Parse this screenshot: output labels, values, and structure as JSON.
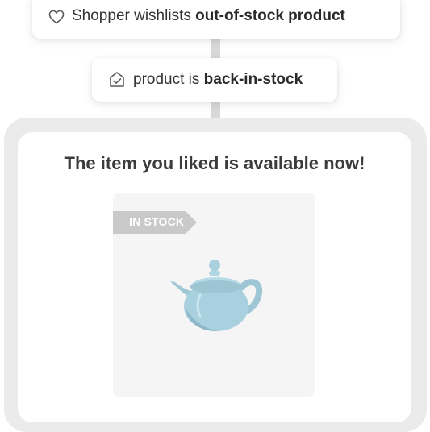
{
  "trigger": {
    "icon": "heart-icon",
    "prefix": "Shopper wishlists ",
    "bold": "out-of-stock product"
  },
  "condition": {
    "icon": "tag-check-icon",
    "prefix": "product is ",
    "bold": "back-in-stock"
  },
  "message": {
    "headline": "The item you liked is available now!",
    "badge": "IN STOCK",
    "product_image": "teapot-icon"
  },
  "colors": {
    "badge": "#c9c9c9",
    "teapot": "#a9d0de",
    "card": "#f5f5f5",
    "frame": "#ebebeb",
    "connector": "#d9d9d9"
  }
}
